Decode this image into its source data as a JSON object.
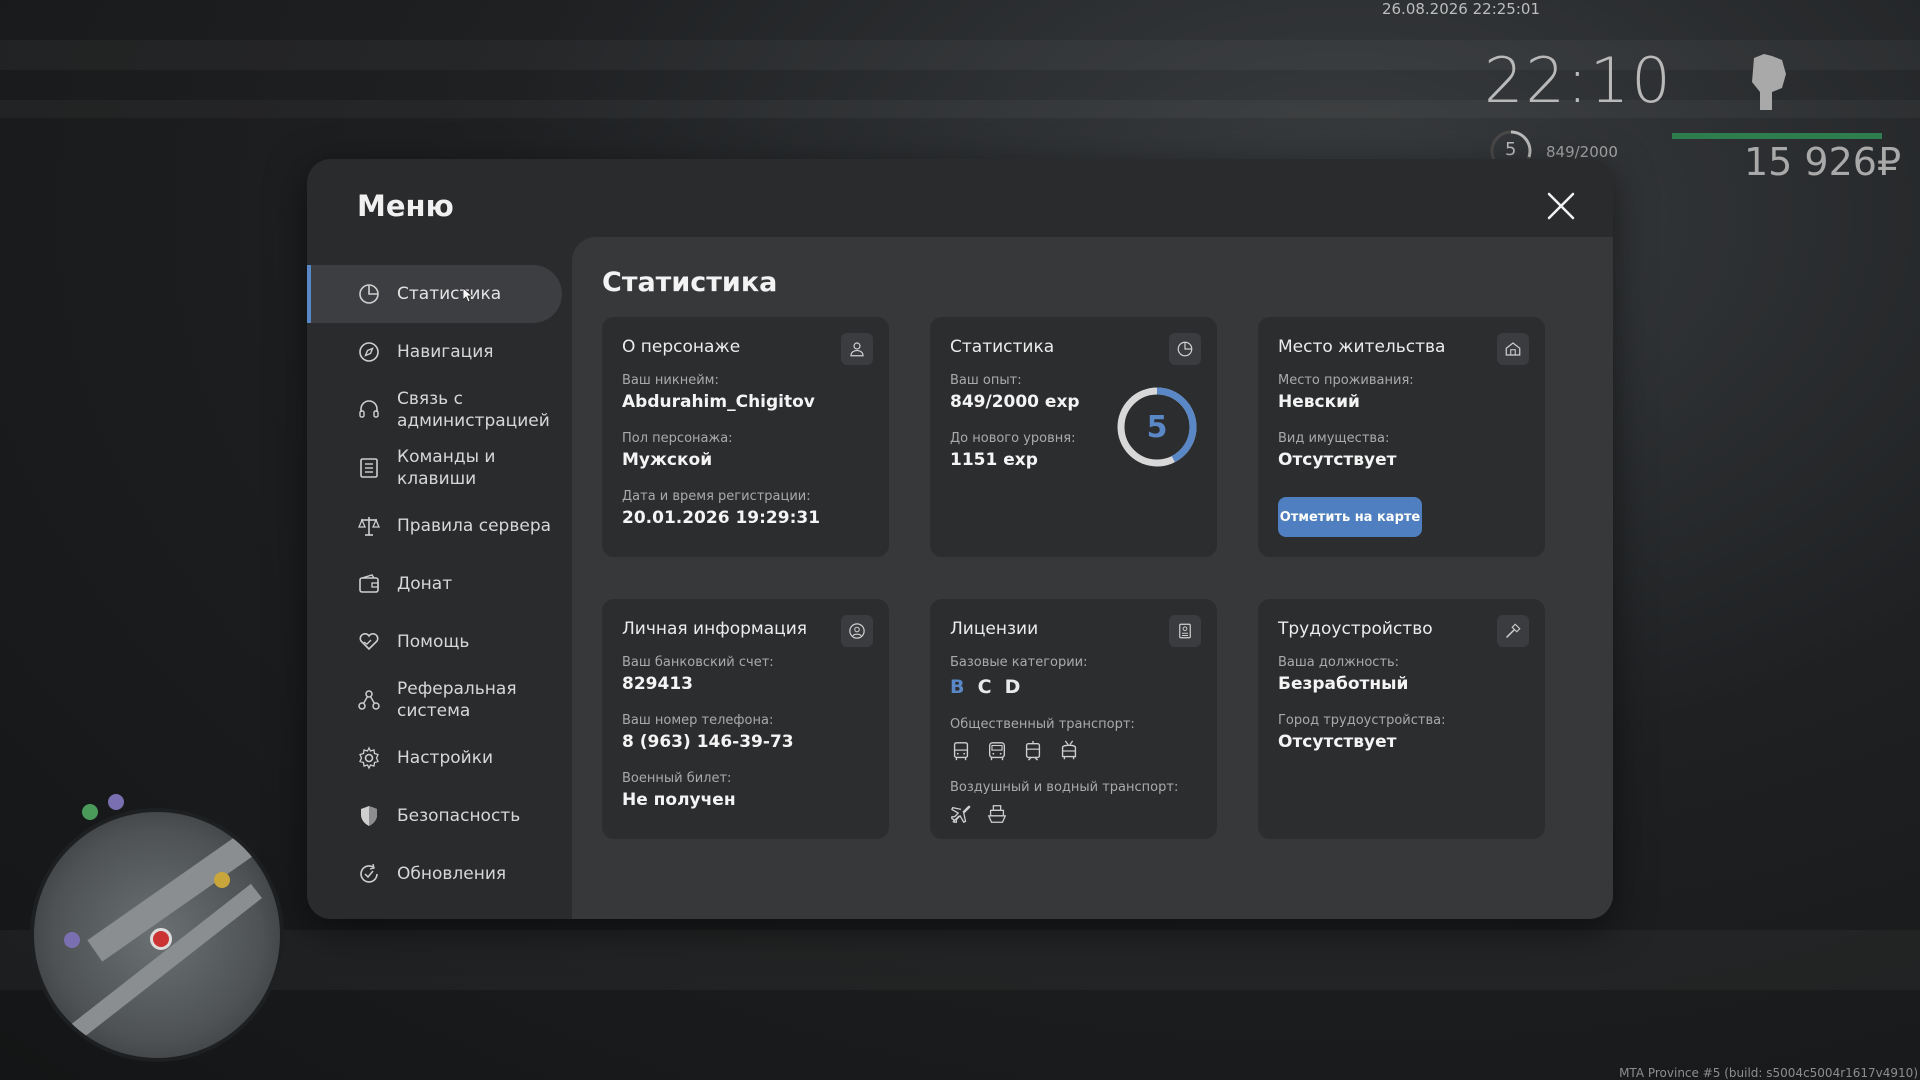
{
  "hud": {
    "datetime": "26.08.2026 22:25:01",
    "clock": "22:10",
    "level": "5",
    "exp": "849/2000",
    "money": "15 926₽",
    "build": "MTA Province #5 (build: s5004c5004r1617v4910)"
  },
  "menu": {
    "title": "Меню",
    "nav": [
      {
        "label": "Статистика",
        "icon": "pie-chart-icon",
        "active": true
      },
      {
        "label": "Навигация",
        "icon": "compass-icon"
      },
      {
        "label": "Связь с администрацией",
        "icon": "headset-icon"
      },
      {
        "label": "Команды и клавиши",
        "icon": "document-list-icon"
      },
      {
        "label": "Правила сервера",
        "icon": "scales-icon"
      },
      {
        "label": "Донат",
        "icon": "wallet-icon"
      },
      {
        "label": "Помощь",
        "icon": "heart-hands-icon"
      },
      {
        "label": "Реферальная система",
        "icon": "referral-network-icon"
      },
      {
        "label": "Настройки",
        "icon": "gear-icon"
      },
      {
        "label": "Безопасность",
        "icon": "shield-icon"
      },
      {
        "label": "Обновления",
        "icon": "refresh-check-icon"
      }
    ]
  },
  "content": {
    "title": "Статистика",
    "character": {
      "title": "О персонаже",
      "icon": "user-icon",
      "nickname_label": "Ваш никнейм:",
      "nickname": "Abdurahim_Chigitov",
      "gender_label": "Пол персонажа:",
      "gender": "Мужской",
      "reg_label": "Дата и время регистрации:",
      "reg_date": "20.01.2026 19:29:31"
    },
    "stats": {
      "title": "Статистика",
      "icon": "pie-chart-icon",
      "exp_label": "Ваш опыт:",
      "exp": "849/2000 exp",
      "next_label": "До нового уровня:",
      "next": "1151 exp",
      "level": "5",
      "progress": 0.4245
    },
    "residence": {
      "title": "Место жительства",
      "icon": "house-icon",
      "place_label": "Место проживания:",
      "place": "Невский",
      "property_label": "Вид имущества:",
      "property": "Отсутствует",
      "map_button": "Отметить на карте"
    },
    "personal": {
      "title": "Личная информация",
      "icon": "user-circle-icon",
      "bank_label": "Ваш банковский счет:",
      "bank": "829413",
      "phone_label": "Ваш номер телефона:",
      "phone": "8 (963) 146-39-73",
      "military_label": "Военный билет:",
      "military": "Не получен"
    },
    "licenses": {
      "title": "Лицензии",
      "icon": "id-card-icon",
      "base_label": "Базовые категории:",
      "categories": [
        "B",
        "C",
        "D"
      ],
      "category_colors": [
        "#5a87c6",
        "#f4f4f4",
        "#f4f4f4"
      ],
      "public_label": "Общественный транспорт:",
      "public_icons": [
        "bus-icon",
        "coach-icon",
        "tram-icon",
        "trolleybus-icon"
      ],
      "airwater_label": "Воздушный и водный транспорт:",
      "airwater_icons": [
        "airplane-icon",
        "boat-icon"
      ]
    },
    "job": {
      "title": "Трудоустройство",
      "icon": "hammer-icon",
      "position_label": "Ваша должность:",
      "position": "Безработный",
      "city_label": "Город трудоустройства:",
      "city": "Отсутствует"
    }
  },
  "colors": {
    "accent": "#5a87c6",
    "button": "#4f7fc0",
    "hp": "#2e7d4f"
  }
}
